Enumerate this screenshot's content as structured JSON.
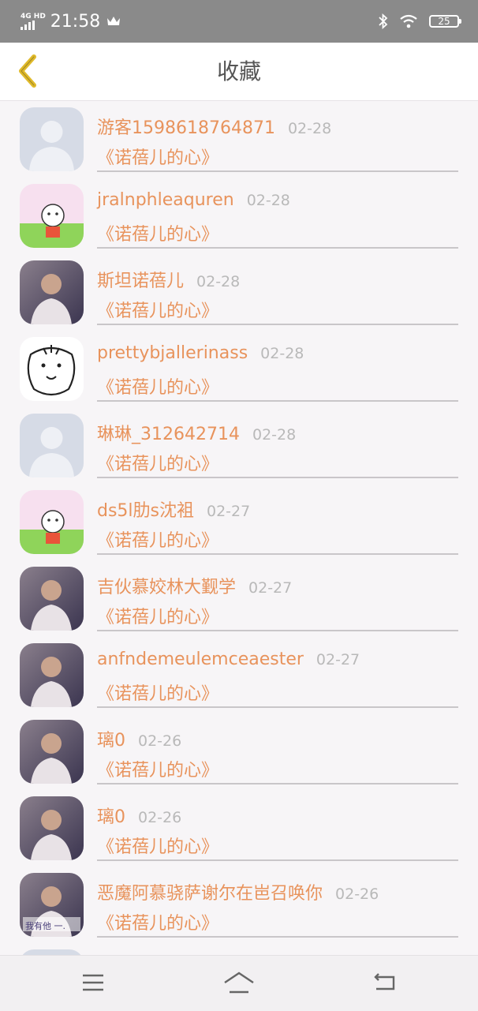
{
  "status_bar": {
    "network": "4G HD",
    "time": "21:58",
    "battery": "25",
    "icons": [
      "signal-icon",
      "crown-icon",
      "bluetooth-icon",
      "wifi-icon",
      "battery-icon"
    ]
  },
  "header": {
    "title": "收藏",
    "back_icon": "chevron-left-icon"
  },
  "colors": {
    "accent": "#e8935c",
    "date": "#b9b9b9",
    "back_arrow": "#e0ba2a",
    "statusbar": "#8a8a8a"
  },
  "items": [
    {
      "username": "游客1598618764871",
      "date": "02-28",
      "song": "《诺蓓儿的心》",
      "avatar": "default-avatar"
    },
    {
      "username": "jralnphleaquren",
      "date": "02-28",
      "song": "《诺蓓儿的心》",
      "avatar": "cartoon-avatar"
    },
    {
      "username": "斯坦诺蓓儿",
      "date": "02-28",
      "song": "《诺蓓儿的心》",
      "avatar": "photo-avatar"
    },
    {
      "username": "prettybjallerinass",
      "date": "02-28",
      "song": "《诺蓓儿的心》",
      "avatar": "tiger-sketch-avatar"
    },
    {
      "username": "琳琳_312642714",
      "date": "02-28",
      "song": "《诺蓓儿的心》",
      "avatar": "default-avatar"
    },
    {
      "username": "ds5l肋s沈袓",
      "date": "02-27",
      "song": "《诺蓓儿的心》",
      "avatar": "cartoon-avatar"
    },
    {
      "username": "吉伙慕姣林大觐学",
      "date": "02-27",
      "song": "《诺蓓儿的心》",
      "avatar": "photo-avatar"
    },
    {
      "username": "anfndemeulemceaester",
      "date": "02-27",
      "song": "《诺蓓儿的心》",
      "avatar": "photo-avatar"
    },
    {
      "username": "璃0",
      "date": "02-26",
      "song": "《诺蓓儿的心》",
      "avatar": "photo-avatar"
    },
    {
      "username": "璃0",
      "date": "02-26",
      "song": "《诺蓓儿的心》",
      "avatar": "photo-avatar"
    },
    {
      "username": "恶魔阿慕骁萨谢尔在岜召唤你",
      "date": "02-26",
      "song": "《诺蓓儿的心》",
      "avatar": "photo-avatar",
      "avatar_caption": "我有他 一."
    }
  ],
  "nav_bar": {
    "icons": [
      "menu-icon",
      "home-icon",
      "back-icon"
    ]
  }
}
